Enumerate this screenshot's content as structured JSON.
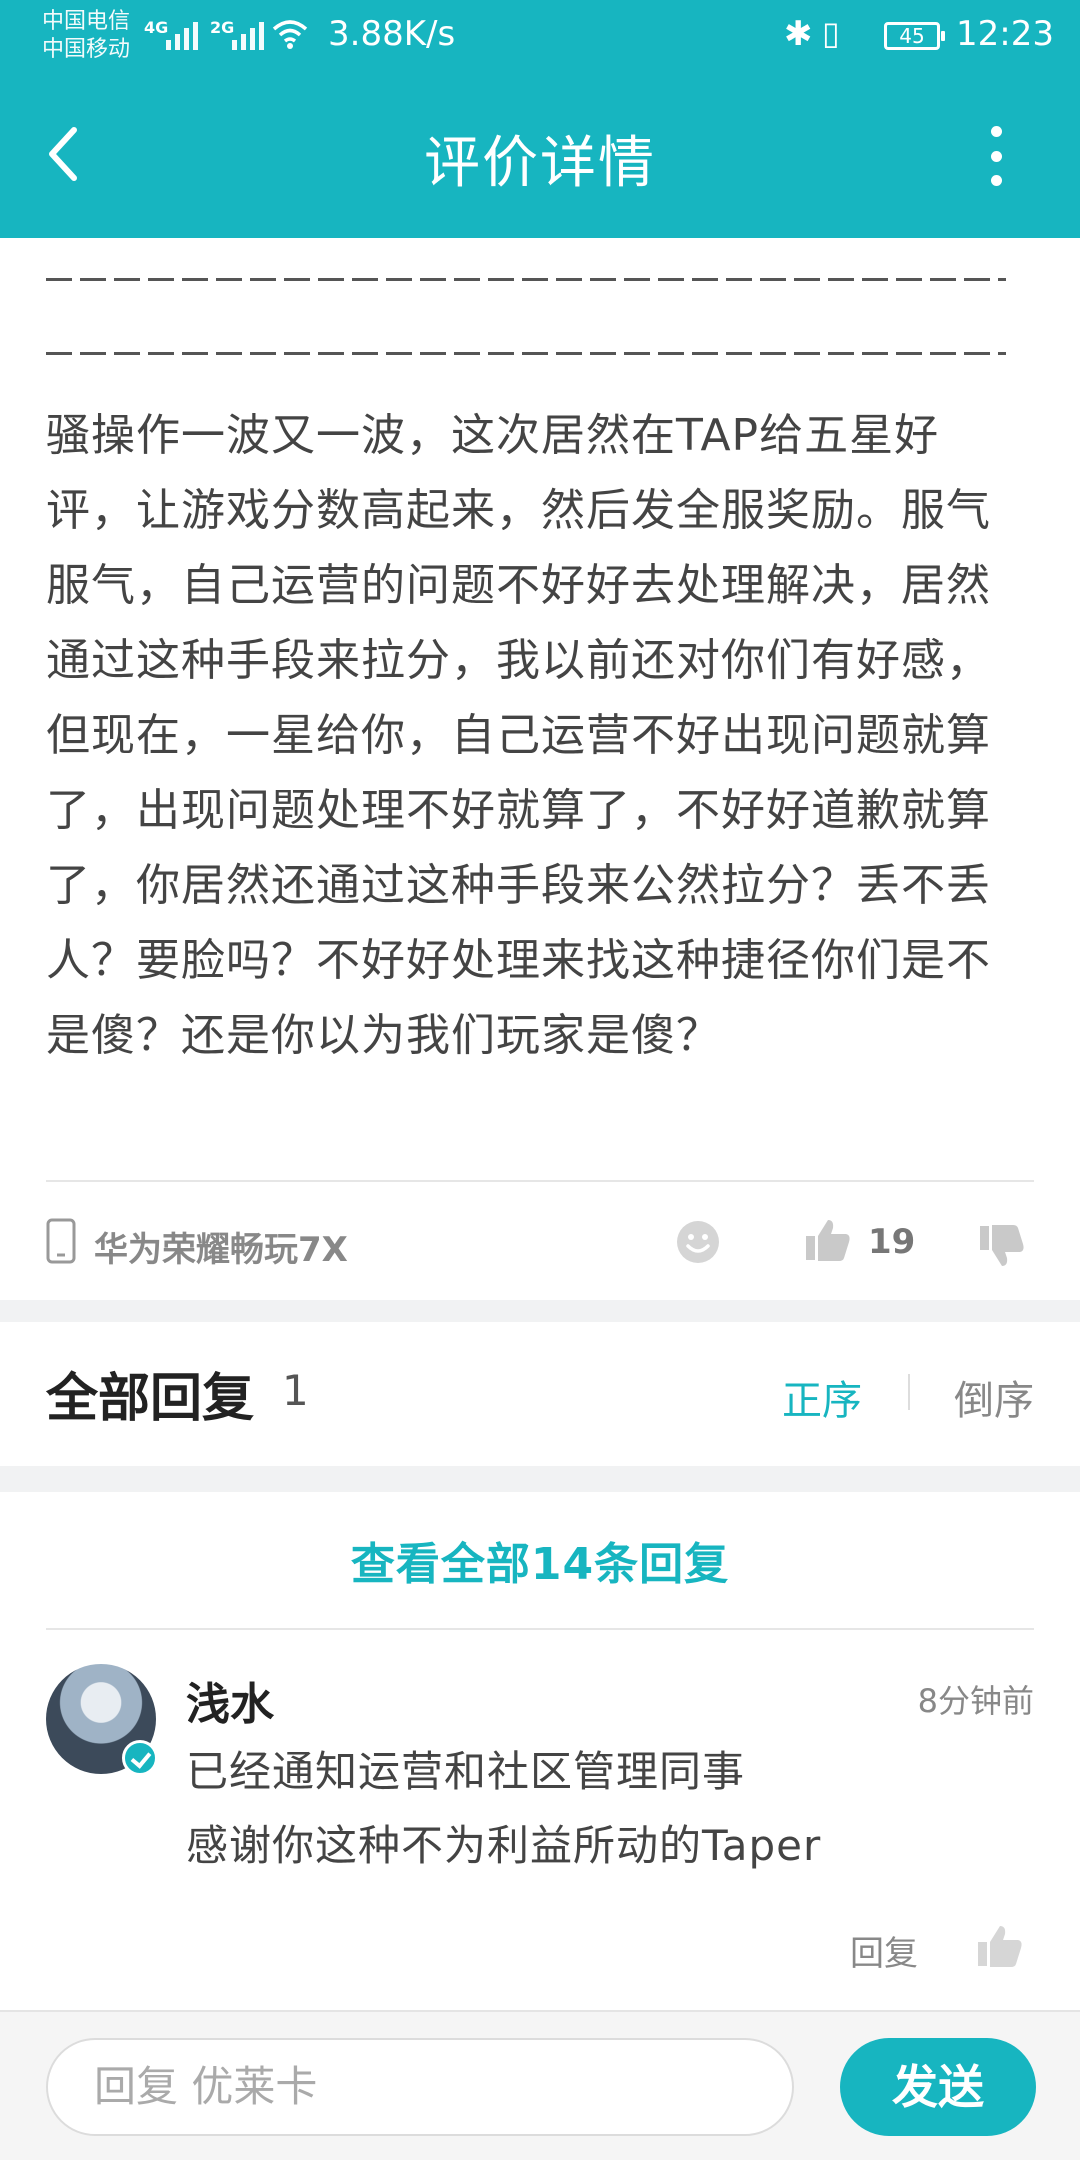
{
  "status_bar": {
    "carrier1": "中国电信",
    "carrier2": "中国移动",
    "net1": "4G",
    "net2": "2G",
    "speed": "3.88K/s",
    "battery": "45",
    "time": "12:23"
  },
  "header": {
    "title": "评价详情"
  },
  "review": {
    "text": "骚操作一波又一波，这次居然在TAP给五星好评，让游戏分数高起来，然后发全服奖励。服气服气，自己运营的问题不好好去处理解决，居然通过这种手段来拉分，我以前还对你们有好感，但现在，一星给你，自己运营不好出现问题就算了，出现问题处理不好就算了，不好好道歉就算了，你居然还通过这种手段来公然拉分？丢不丢人？要脸吗？不好好处理来找这种捷径你们是不是傻？还是你以为我们玩家是傻？",
    "device": "华为荣耀畅玩7X",
    "likes": "19"
  },
  "replies": {
    "title": "全部回复",
    "count": "1",
    "sort_asc": "正序",
    "sort_desc": "倒序",
    "view_all": "查看全部14条回复"
  },
  "comment": {
    "name": "浅水",
    "time": "8分钟前",
    "line1": "已经通知运营和社区管理同事",
    "line2": "感谢你这种不为利益所动的Taper",
    "reply_label": "回复"
  },
  "bottom_bar": {
    "placeholder": "回复 优莱卡",
    "send_label": "发送"
  },
  "colors": {
    "accent": "#17b5c0"
  }
}
